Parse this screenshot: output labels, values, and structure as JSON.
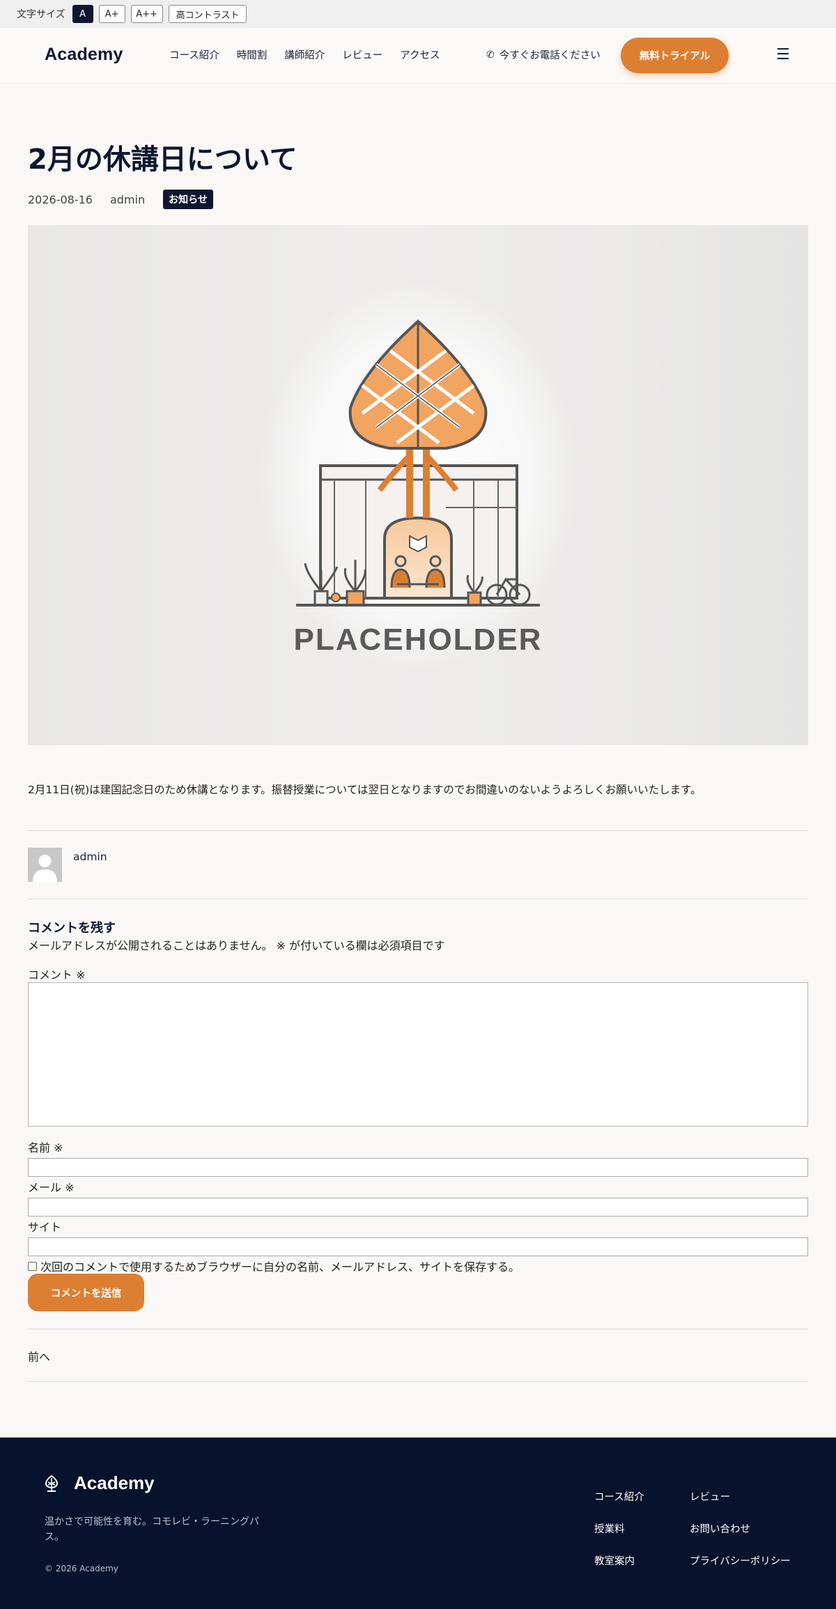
{
  "a11y": {
    "label": "文字サイズ",
    "buttons": [
      "A",
      "A+",
      "A++",
      "高コントラスト"
    ]
  },
  "header": {
    "logo": "Academy",
    "nav": [
      "コース紹介",
      "時間割",
      "講師紹介",
      "レビュー",
      "アクセス"
    ],
    "phone": "今すぐお電話ください",
    "cta": "無料トライアル"
  },
  "post": {
    "title": "2月の休講日について",
    "date": "2026-08-16",
    "author": "admin",
    "category": "お知らせ",
    "image_text": "PLACEHOLDER",
    "body": "2月11日(祝)は建国記念日のため休講となります。振替授業については翌日となりますのでお間違いのないようよろしくお願いいたします。"
  },
  "author_box": {
    "name": "admin"
  },
  "comment_form": {
    "title": "コメントを残す",
    "notes": "メールアドレスが公開されることはありません。 ※ が付いている欄は必須項目です",
    "comment_label": "コメント ※",
    "name_label": "名前 ※",
    "email_label": "メール ※",
    "site_label": "サイト",
    "consent": "次回のコメントで使用するためブラウザーに自分の名前、メールアドレス、サイトを保存する。",
    "submit": "コメントを送信"
  },
  "post_nav": {
    "prev": "前へ"
  },
  "footer": {
    "logo": "Academy",
    "tagline": "温かさで可能性を育む。コモレビ・ラーニングパス。",
    "copyright": "© 2026 Academy",
    "links": [
      "コース紹介",
      "レビュー",
      "授業料",
      "お問い合わせ",
      "教室案内",
      "プライバシーポリシー"
    ]
  },
  "colors": {
    "accent": "#dd7f32",
    "navy": "#0f1730",
    "footer_bg": "#07122c"
  }
}
